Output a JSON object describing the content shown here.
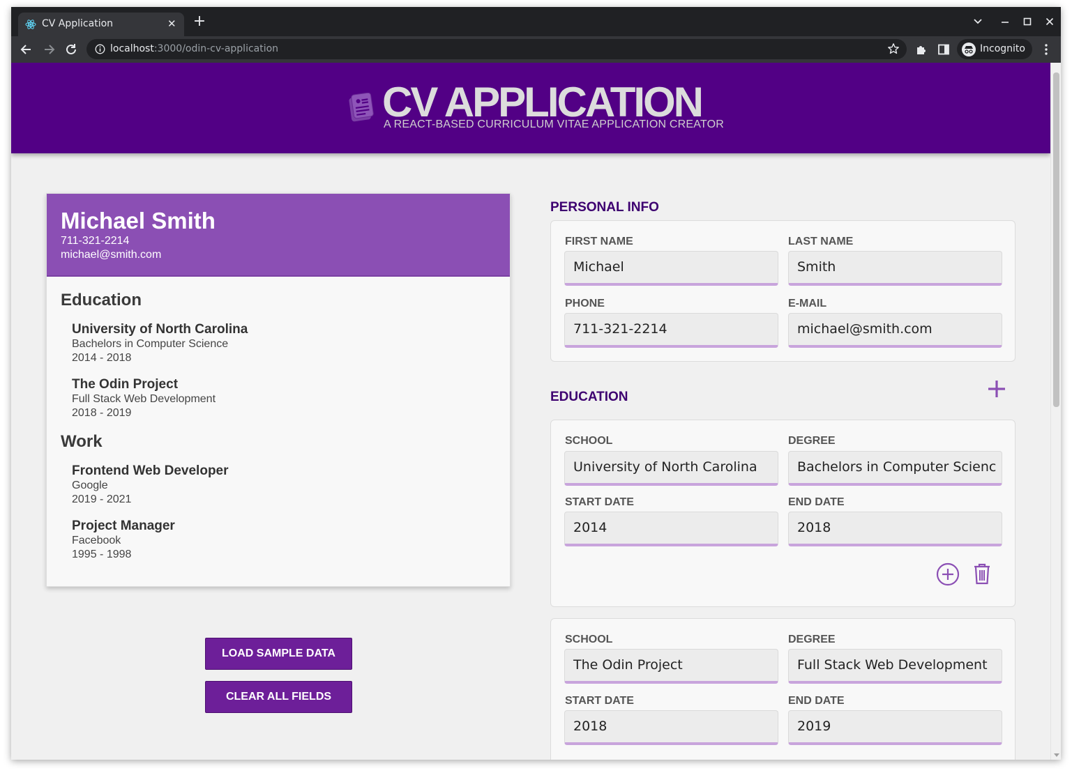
{
  "browser": {
    "tab_title": "CV Application",
    "url_host": "localhost",
    "url_path": ":3000/odin-cv-application",
    "profile_label": "Incognito"
  },
  "header": {
    "title": "CV APPLICATION",
    "subtitle": "A REACT-BASED CURRICULUM VITAE APPLICATION CREATOR"
  },
  "preview": {
    "name": "Michael Smith",
    "phone": "711-321-2214",
    "email": "michael@smith.com",
    "education_heading": "Education",
    "education": [
      {
        "school": "University of North Carolina",
        "degree": "Bachelors in Computer Science",
        "dates": "2014 - 2018"
      },
      {
        "school": "The Odin Project",
        "degree": "Full Stack Web Development",
        "dates": "2018 - 2019"
      }
    ],
    "work_heading": "Work",
    "work": [
      {
        "title": "Frontend Web Developer",
        "company": "Google",
        "dates": "2019 - 2021"
      },
      {
        "title": "Project Manager",
        "company": "Facebook",
        "dates": "1995 - 1998"
      }
    ]
  },
  "buttons": {
    "load_sample": "LOAD SAMPLE DATA",
    "clear_all": "CLEAR ALL FIELDS"
  },
  "personal_info": {
    "heading": "PERSONAL INFO",
    "first_name_label": "FIRST NAME",
    "first_name": "Michael",
    "last_name_label": "LAST NAME",
    "last_name": "Smith",
    "phone_label": "PHONE",
    "phone": "711-321-2214",
    "email_label": "E-MAIL",
    "email": "michael@smith.com"
  },
  "education_form": {
    "heading": "EDUCATION",
    "school_label": "SCHOOL",
    "degree_label": "DEGREE",
    "start_label": "START DATE",
    "end_label": "END DATE",
    "entries": [
      {
        "school": "University of North Carolina",
        "degree": "Bachelors in Computer Scienc",
        "start": "2014",
        "end": "2018"
      },
      {
        "school": "The Odin Project",
        "degree": "Full Stack Web Development",
        "start": "2018",
        "end": "2019"
      }
    ]
  },
  "colors": {
    "header_bg": "#520085",
    "preview_head": "#8b4fb4",
    "button_bg": "#6d1f99",
    "accent": "#8b4fb4"
  }
}
